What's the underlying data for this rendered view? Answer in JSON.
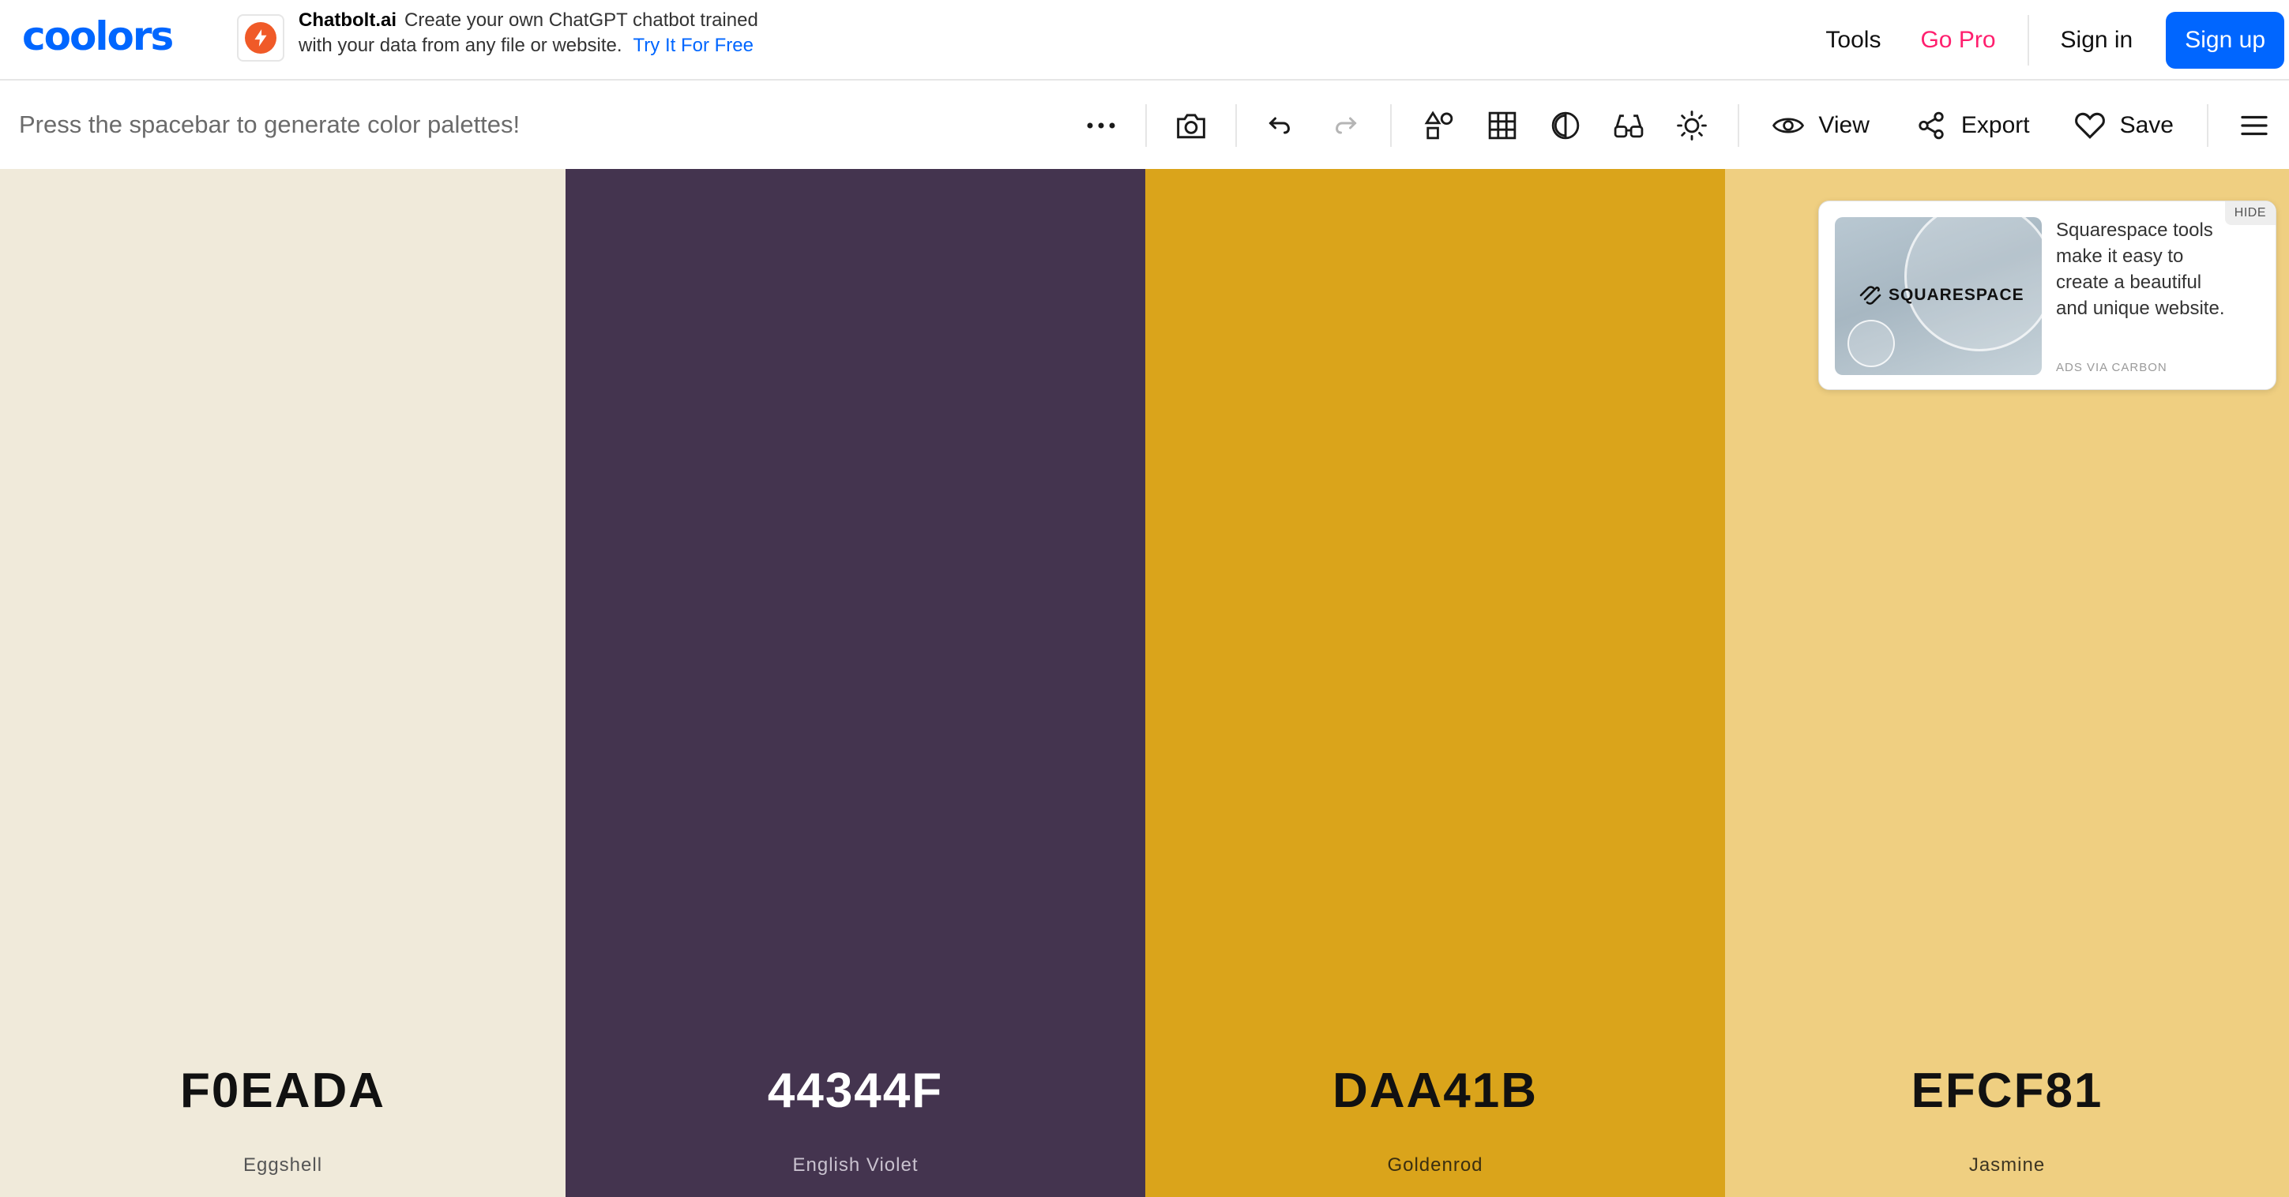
{
  "header": {
    "logo": "coolors",
    "ad": {
      "brand": "Chatbolt.ai",
      "text_line1": "Create your own ChatGPT chatbot trained",
      "text_line2": "with your data from any file or website.",
      "cta": "Try It For Free",
      "icon": "lightning-logo-icon"
    },
    "nav": {
      "tools": "Tools",
      "go_pro": "Go Pro",
      "sign_in": "Sign in",
      "sign_up": "Sign up"
    }
  },
  "toolbar": {
    "hint": "Press the spacebar to generate color palettes!",
    "icons": [
      "more-icon",
      "camera-icon",
      "undo-icon",
      "redo-icon",
      "shapes-icon",
      "grid-icon",
      "contrast-icon",
      "glasses-icon",
      "brightness-icon",
      "eye-icon",
      "share-icon",
      "heart-icon",
      "menu-icon"
    ],
    "view_label": "View",
    "export_label": "Export",
    "save_label": "Save"
  },
  "palette": [
    {
      "hex": "F0EADA",
      "name": "Eggshell",
      "color": "#F0EADA",
      "text_color": "#111111",
      "name_color": "#555555"
    },
    {
      "hex": "44344F",
      "name": "English Violet",
      "color": "#44344F",
      "text_color": "#ffffff",
      "name_color": "#c9c2cf"
    },
    {
      "hex": "DAA41B",
      "name": "Goldenrod",
      "color": "#DAA41B",
      "text_color": "#111111",
      "name_color": "#3a2e10"
    },
    {
      "hex": "EFCF81",
      "name": "Jasmine",
      "color": "#EFCF81",
      "text_color": "#111111",
      "name_color": "#3d3522"
    }
  ],
  "carbon_ad": {
    "brand_mark": "SQUARESPACE",
    "copy": "Squarespace tools make it easy to create a beautiful and unique website.",
    "via": "ADS VIA CARBON",
    "hide": "HIDE"
  }
}
